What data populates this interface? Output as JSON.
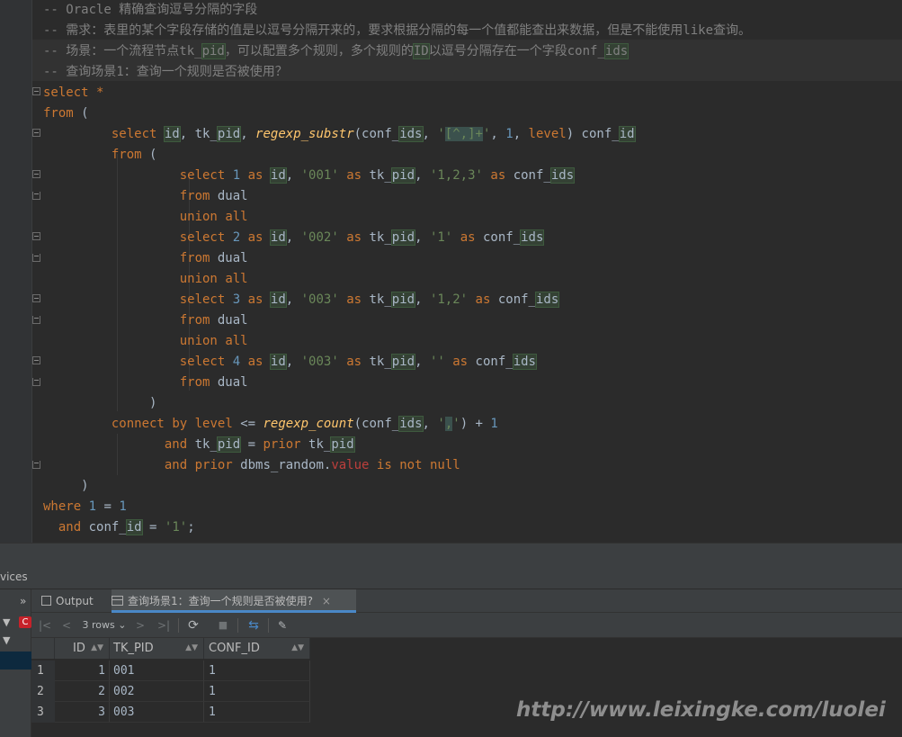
{
  "editor": {
    "lines": [
      "-- Oracle 精确查询逗号分隔的字段",
      "-- 需求：表里的某个字段存储的值是以逗号分隔开来的，要求根据分隔的每一个值都能查出来数据，但是不能使用like查询。",
      "-- 场景：一个流程节点tk_pid，可以配置多个规则，多个规则的ID以逗号分隔存在一个字段conf_ids",
      "-- 查询场景1：查询一个规则是否被使用？",
      "select *",
      "from (",
      "         select id, tk_pid, regexp_substr(conf_ids, '[^,]+', 1, level) conf_id",
      "         from (",
      "                  select 1 as id, '001' as tk_pid, '1,2,3' as conf_ids",
      "                  from dual",
      "                  union all",
      "                  select 2 as id, '002' as tk_pid, '1' as conf_ids",
      "                  from dual",
      "                  union all",
      "                  select 3 as id, '003' as tk_pid, '1,2' as conf_ids",
      "                  from dual",
      "                  union all",
      "                  select 4 as id, '003' as tk_pid, '' as conf_ids",
      "                  from dual",
      "              )",
      "         connect by level <= regexp_count(conf_ids, ',') + 1",
      "                and tk_pid = prior tk_pid",
      "                and prior dbms_random.value is not null",
      "     )",
      "where 1 = 1",
      "  and conf_id = '1';"
    ]
  },
  "services": {
    "label": "vices"
  },
  "tabs": {
    "output_label": "Output",
    "query_label": "查询场景1：查询一个规则是否被使用?",
    "close_glyph": "×",
    "overflow_glyph": "»"
  },
  "toolbar": {
    "first": "|<",
    "prev": "<",
    "rows_label": "3 rows",
    "next": ">",
    "last": ">|",
    "refresh": "⟳",
    "stop": "■",
    "pin": "✎"
  },
  "grid": {
    "columns": [
      "ID",
      "TK_PID",
      "CONF_ID"
    ],
    "rows": [
      [
        "1",
        "001",
        "1"
      ],
      [
        "2",
        "002",
        "1"
      ],
      [
        "3",
        "003",
        "1"
      ]
    ],
    "row_numbers": [
      "1",
      "2",
      "3"
    ]
  },
  "watermark": "http://www.leixingke.com/luolei",
  "colors": {
    "keyword": "#cc7832",
    "string": "#6a8759",
    "number": "#6897bb",
    "comment": "#808080",
    "function": "#ffc66d"
  }
}
